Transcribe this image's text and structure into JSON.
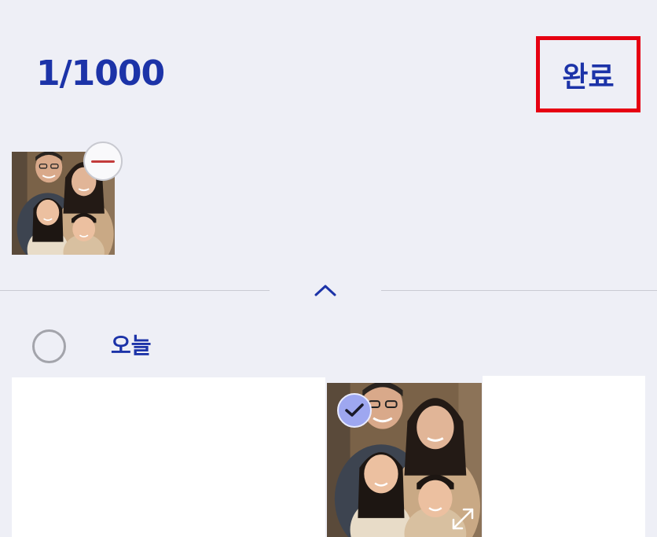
{
  "header": {
    "counter": "1/1000",
    "done_label": "완료"
  },
  "selected_strip": {
    "items": [
      {
        "icon": "family-photo-thumbnail",
        "remove_icon": "minus-icon"
      }
    ]
  },
  "collapse_icon": "chevron-up-icon",
  "group": {
    "title": "오늘",
    "select_all_icon": "empty-circle-icon"
  },
  "grid": {
    "items": [
      {
        "type": "blank"
      },
      {
        "type": "photo",
        "icon": "family-photo-thumbnail",
        "checked": true,
        "check_icon": "checkmark-icon",
        "expand_icon": "expand-icon"
      },
      {
        "type": "blank"
      }
    ]
  },
  "colors": {
    "accent": "#1c33a8",
    "highlight_border": "#e60012",
    "background": "#eeeff6",
    "check_badge": "#9ea7f0",
    "remove_bar": "#c23b3b"
  }
}
